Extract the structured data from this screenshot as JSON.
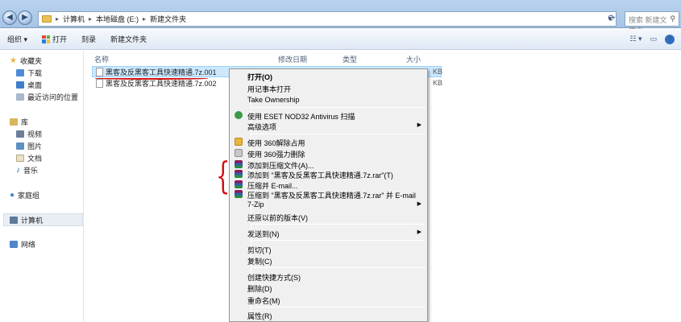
{
  "address": {
    "crumbs": [
      "计算机",
      "本地磁盘 (E:)",
      "新建文件夹"
    ],
    "search_placeholder": "搜索 新建文件夹"
  },
  "toolbar": {
    "organize": "组织 ▾",
    "open": "打开",
    "burn": "刻录",
    "new_folder": "新建文件夹"
  },
  "nav": {
    "favorites": "收藏夹",
    "downloads": "下载",
    "desktop": "桌面",
    "recent": "最近访问的位置",
    "library": "库",
    "videos": "视频",
    "pictures": "图片",
    "documents": "文档",
    "music": "音乐",
    "homegroup": "家庭组",
    "computer": "计算机",
    "network": "网络"
  },
  "columns": {
    "name": "名称",
    "modified": "修改日期",
    "type": "类型",
    "size": "大小"
  },
  "files": [
    {
      "name": "黑客及反黑客工具快速精通.7z.001",
      "size": "KB"
    },
    {
      "name": "黑客及反黑客工具快速精通.7z.002",
      "size": "KB"
    }
  ],
  "menu": {
    "open": "打开(O)",
    "notepad": "用记事本打开",
    "ownership": "Take Ownership",
    "eset": "使用 ESET NOD32 Antivirus 扫描",
    "advanced": "高级选项",
    "unlock360": "使用 360解除占用",
    "delete360": "使用 360强力删除",
    "add_archive": "添加到压缩文件(A)...",
    "add_rar": "添加到 \"黑客及反黑客工具快速精通.7z.rar\"(T)",
    "email": "压缩并 E-mail...",
    "rar_email": "压缩到 \"黑客及反黑客工具快速精通.7z.rar\" 并 E-mail",
    "zip7": "7-Zip",
    "restore": "还原以前的版本(V)",
    "sendto": "发送到(N)",
    "cut": "剪切(T)",
    "copy": "复制(C)",
    "shortcut": "创建快捷方式(S)",
    "delete": "删除(D)",
    "rename": "重命名(M)",
    "properties": "属性(R)"
  },
  "colors": {
    "annotation": "#d01010",
    "selection": "#cce8ff"
  }
}
